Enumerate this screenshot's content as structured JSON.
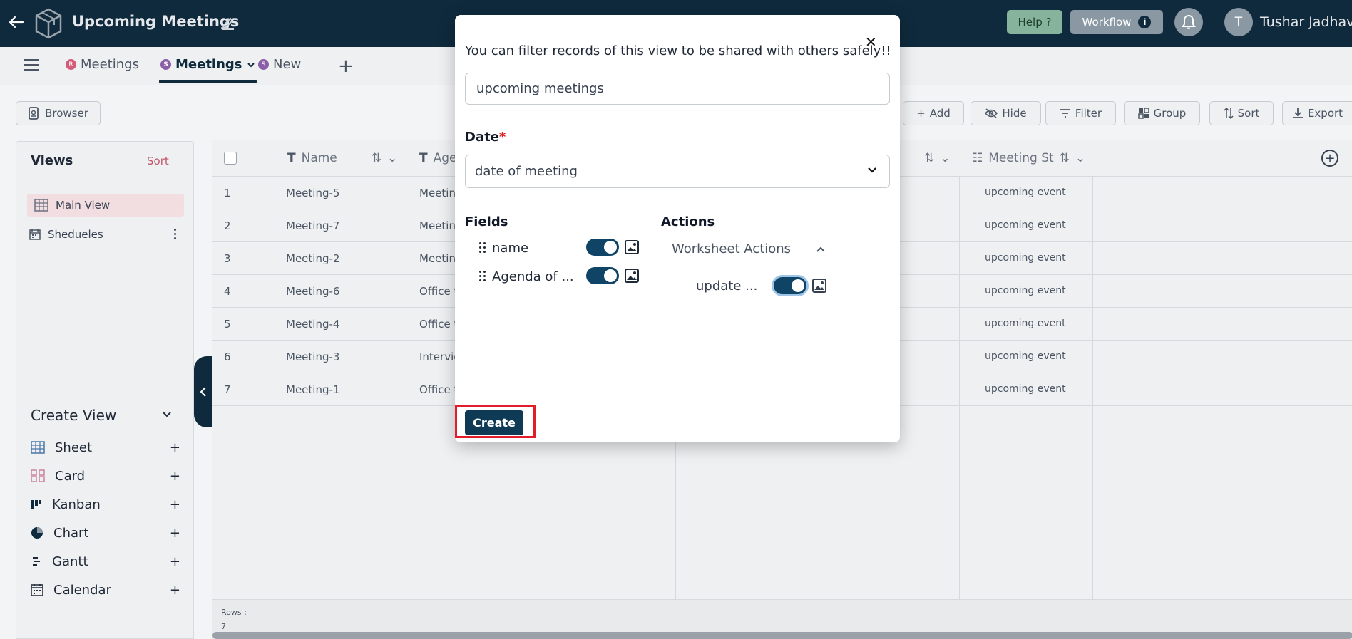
{
  "header": {
    "title": "Upcoming Meetings",
    "help_label": "Help ?",
    "workflow_label": "Workflow",
    "workflow_info": "i",
    "avatar_initial": "T",
    "user_name": "Tushar Jadhav"
  },
  "tabs": [
    {
      "badge": "R",
      "label": "Meetings"
    },
    {
      "badge": "S",
      "label": "Meetings"
    },
    {
      "badge": "S",
      "label": "New"
    }
  ],
  "toolbar": {
    "browser": "Browser",
    "add": "Add",
    "hide": "Hide",
    "filter": "Filter",
    "group": "Group",
    "sort": "Sort",
    "export": "Export"
  },
  "views": {
    "title": "Views",
    "sort_label": "Sort",
    "items": [
      "Main View",
      "Shedueles"
    ]
  },
  "create_view": {
    "title": "Create View",
    "items": [
      "Sheet",
      "Card",
      "Kanban",
      "Chart",
      "Gantt",
      "Calendar"
    ]
  },
  "grid": {
    "columns": [
      "Name",
      "Age",
      "Meeting St"
    ],
    "rows": [
      {
        "num": "1",
        "name": "Meeting-5",
        "agenda": "Meetin",
        "status": "upcoming event"
      },
      {
        "num": "2",
        "name": "Meeting-7",
        "agenda": "Meetin",
        "status": "upcoming event"
      },
      {
        "num": "3",
        "name": "Meeting-2",
        "agenda": "Meetin",
        "status": "upcoming event"
      },
      {
        "num": "4",
        "name": "Meeting-6",
        "agenda": "Office t",
        "status": "upcoming event"
      },
      {
        "num": "5",
        "name": "Meeting-4",
        "agenda": "Office t",
        "status": "upcoming event"
      },
      {
        "num": "6",
        "name": "Meeting-3",
        "agenda": "Intervie",
        "status": "upcoming event"
      },
      {
        "num": "7",
        "name": "Meeting-1",
        "agenda": "Office t",
        "status": "upcoming event"
      }
    ],
    "rows_label": "Rows :",
    "rows_count": "7"
  },
  "modal": {
    "description": "You can filter records of this view to be shared with others safely!!",
    "name_value": "upcoming meetings",
    "date_label": "Date",
    "date_required": "*",
    "date_value": "date of meeting",
    "fields_title": "Fields",
    "fields": [
      "name",
      "Agenda of ..."
    ],
    "actions_title": "Actions",
    "worksheet_actions": "Worksheet Actions",
    "action_item": "update ...",
    "create_label": "Create"
  },
  "colors": {
    "header_bg": "#0f2a3d",
    "toggle_on": "#0f4466",
    "highlight": "#e11d2b",
    "accent_pink": "#c2566b"
  }
}
